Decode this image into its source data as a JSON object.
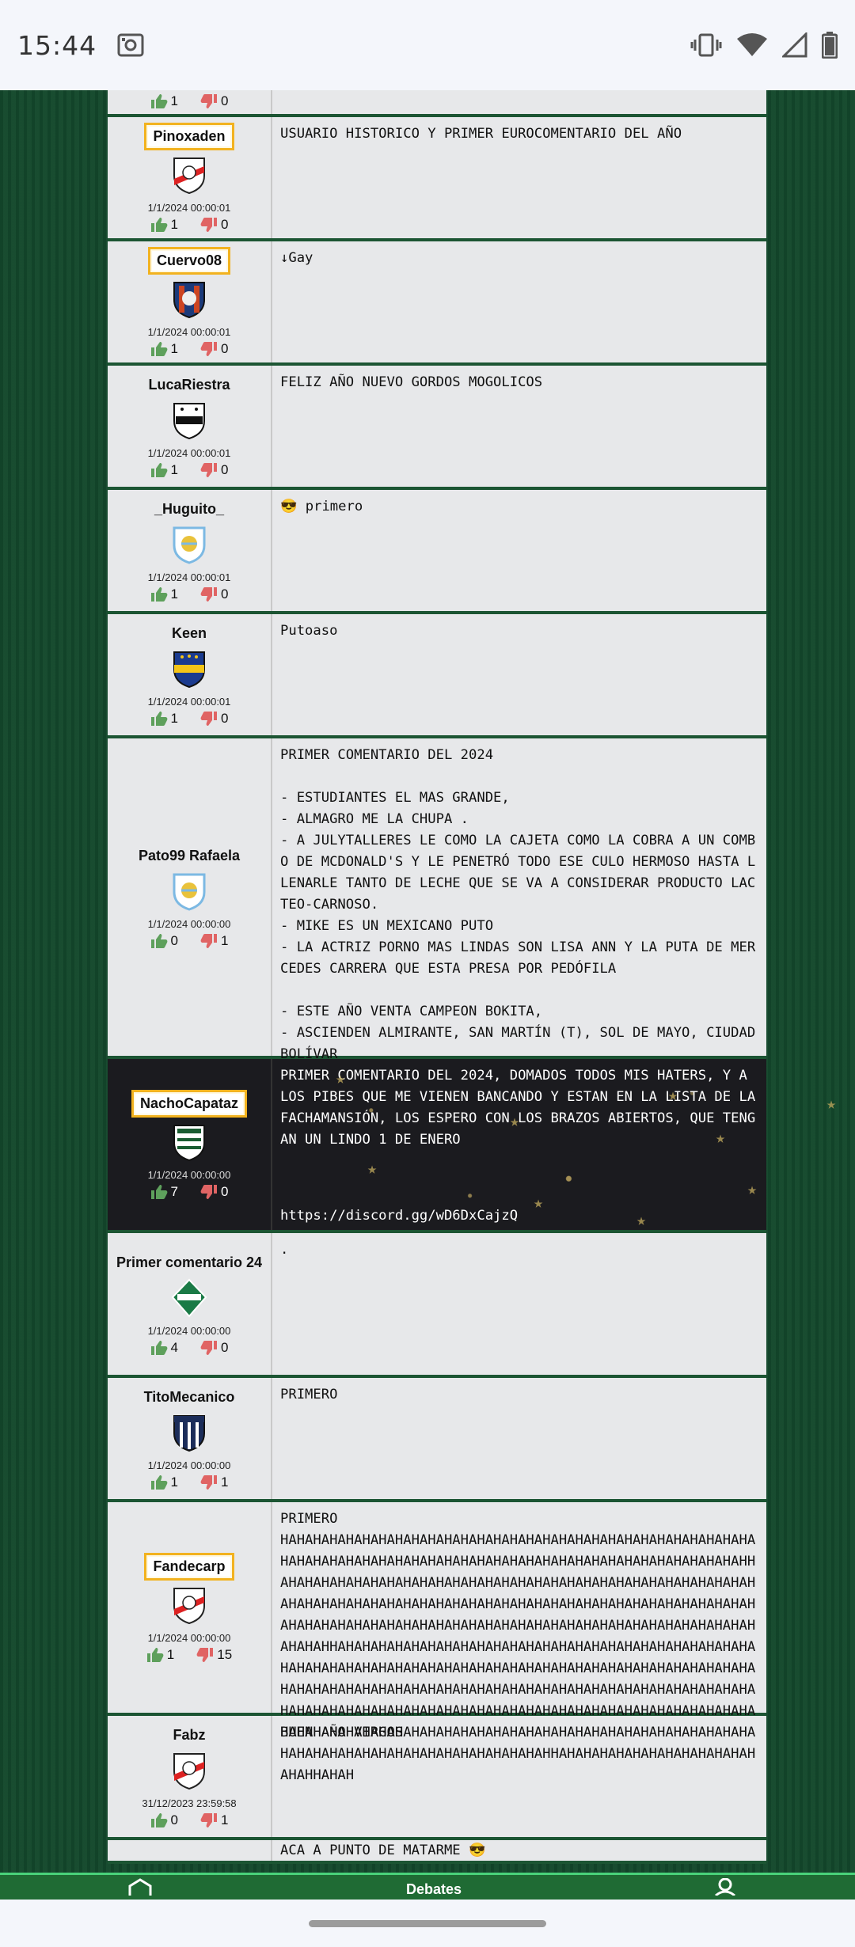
{
  "status_bar": {
    "time": "15:44",
    "icons": [
      "screen-record-icon",
      "vibrate-icon",
      "wifi-icon",
      "signal-icon",
      "battery-icon"
    ]
  },
  "top_partial_votes": {
    "up": "1",
    "down": "0"
  },
  "comments": [
    {
      "user": "Pinoxaden",
      "badge": true,
      "crest": "river-plate-crest",
      "timestamp": "1/1/2024 00:00:01",
      "up": "1",
      "down": "0",
      "text": "USUARIO HISTORICO Y PRIMER EUROCOMENTARIO DEL AÑO"
    },
    {
      "user": "Cuervo08",
      "badge": true,
      "crest": "san-lorenzo-crest",
      "timestamp": "1/1/2024 00:00:01",
      "up": "1",
      "down": "0",
      "text": "↓Gay"
    },
    {
      "user": "LucaRiestra",
      "badge": false,
      "crest": "riestra-crest",
      "timestamp": "1/1/2024 00:00:01",
      "up": "1",
      "down": "0",
      "text": "FELIZ AÑO NUEVO GORDOS MOGOLICOS"
    },
    {
      "user": "_Huguito_",
      "badge": false,
      "crest": "afa-crest",
      "timestamp": "1/1/2024 00:00:01",
      "up": "1",
      "down": "0",
      "text": "😎 primero"
    },
    {
      "user": "Keen",
      "badge": false,
      "crest": "boca-crest",
      "timestamp": "1/1/2024 00:00:01",
      "up": "1",
      "down": "0",
      "text": "Putoaso"
    },
    {
      "user": "Pato99 Rafaela",
      "badge": false,
      "crest": "afa-crest",
      "timestamp": "1/1/2024 00:00:00",
      "up": "0",
      "down": "1",
      "text": "PRIMER COMENTARIO DEL 2024\n\n- ESTUDIANTES EL MAS GRANDE,\n- ALMAGRO ME LA CHUPA .\n- A JULYTALLERES LE COMO LA CAJETA COMO LA COBRA A UN COMBO DE MCDONALD'S Y LE PENETRÓ TODO ESE CULO HERMOSO HASTA LLENARLE TANTO DE LECHE QUE SE VA A CONSIDERAR PRODUCTO LACTEO-CARNOSO.\n- MIKE ES UN MEXICANO PUTO\n- LA ACTRIZ PORNO MAS LINDAS SON LISA ANN Y LA PUTA DE MERCEDES CARRERA QUE ESTA PRESA POR PEDÓFILA\n\n- ESTE AÑO VENTA CAMPEON BOKITA,\n- ASCIENDEN ALMIRANTE, SAN MARTÍN (T), SOL DE MAYO, CIUDAD BOLÍVAR"
    },
    {
      "user": "NachoCapataz",
      "badge": true,
      "dark": true,
      "crest": "nueva-chicago-crest",
      "timestamp": "1/1/2024 00:00:00",
      "up": "7",
      "down": "0",
      "text": "PRIMER COMENTARIO DEL 2024, DOMADOS TODOS MIS HATERS, Y A LOS PIBES QUE ME VIENEN BANCANDO Y ESTAN EN LA LISTA DE LA FACHAMANSIÓN, LOS ESPERO CON LOS BRAZOS ABIERTOS, QUE TENGAN UN LINDO 1 DE ENERO",
      "link": "https://discord.gg/wD6DxCajzQ"
    },
    {
      "user": "Primer comentario 24",
      "badge": false,
      "crest": "ferro-crest",
      "timestamp": "1/1/2024 00:00:00",
      "up": "4",
      "down": "0",
      "text": "."
    },
    {
      "user": "TitoMecanico",
      "badge": false,
      "crest": "talleres-crest",
      "timestamp": "1/1/2024 00:00:00",
      "up": "1",
      "down": "1",
      "text": "PRIMERO"
    },
    {
      "user": "Fandecarp",
      "badge": true,
      "crest": "river-plate-crest",
      "timestamp": "1/1/2024 00:00:00",
      "up": "1",
      "down": "15",
      "text": "PRIMERO\nHAHAHAHAHAHAHAHAHAHAHAHAHAHAHAHAHAHAHAHAHAHAHAHAHAHAHAHAHAHAHAHAHAHAHAHAHAHAHAHAHAHAHAHAHAHAHAHAHAHAHAHAHAHAHAHAHAHHAHAHAHAHAHAHAHAHAHAHAHAHAHAHAHAHAHAHAHAHAHAHAHAHAHAHAHAHAHAHAHAHAHAHAHAHAHAHAHAHAHAHAHAHAHAHAHAHAHAHAHAHAHAHAHAHAHAHAHAHAHAHAHAHAHAHAHAHAHAHAHAHAHAHAHAHAHAHAHAHAHAHAHAHAHAHAHAHAHAHHAHAHAHAHAHAHAHAHAHAHAHAHAHAHAHAHAHAHAHAHAHAHAHAHAHAHAHAHAHAHAHAHAHAHAHAHAHAHAHAHAHAHAHAHAHAHAHAHAHAHAHAHAHAHAHAHAHAHAHAHAHAHAHAHAHAHAHAHAHAHAHAHAHAHAHAHAHAHAHAHAHAHAHAHAHAHAHAHAHAHAHAHAHAHAHAHAHAHAHAHAHAHAHAHAHAHAHAHAHAHAHAHAHAHAHAHAHAHAHAHAHAHAHAHAHAHAHAHAHAHAHAHAHAHAHAHAHAHAHAHAHAHAHAHAHAHAHAHAHAHAHAHAHAHAHAHAHAHHAHAHAHAHAHAHAHAHAHAHAHAHAHAHHAHAH"
    },
    {
      "user": "Fabz",
      "badge": false,
      "crest": "river-plate-crest",
      "timestamp": "31/12/2023 23:59:58",
      "up": "0",
      "down": "1",
      "text": "BUEN AÑO VIRGOS"
    }
  ],
  "partial_bottom_text": "ACA A PUNTO DE MATARME 😎",
  "bottom_nav": {
    "home_icon": "home-icon",
    "label": "Debates",
    "profile_icon": "profile-icon"
  },
  "colors": {
    "background_green": "#14492c",
    "row_bg": "#e7e8ea",
    "badge_gold": "#f2b21f",
    "thumb_up": "#5ea05c",
    "thumb_down": "#e06464",
    "nav_green": "#1f6b34"
  }
}
